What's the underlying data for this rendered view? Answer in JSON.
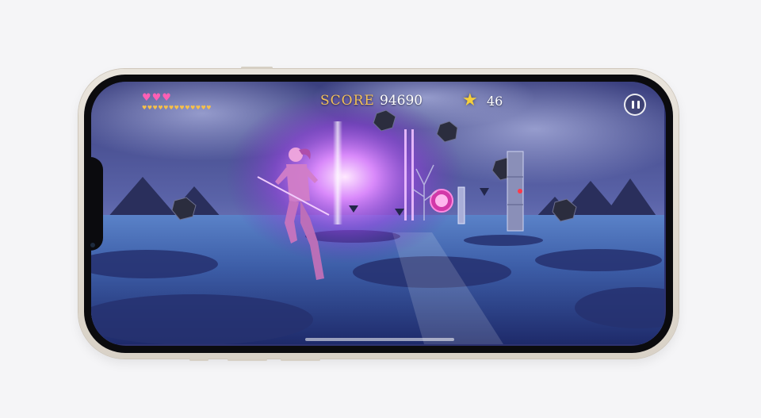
{
  "hud": {
    "hearts_big": "♥♥♥",
    "hearts_small": "♥♥♥♥♥♥♥♥♥♥♥♥♥",
    "score_label": "SCORE",
    "score_value": "94690",
    "star_icon": "★",
    "star_count": "46"
  },
  "colors": {
    "score_label": "#f2c15a",
    "heart_big": "#ff5fb4",
    "heart_small": "#f6c04a",
    "star": "#f5cf3b",
    "glow": "#c46cff"
  },
  "icons": {
    "pause": "pause-icon",
    "star": "star-icon",
    "heart": "heart-icon"
  }
}
